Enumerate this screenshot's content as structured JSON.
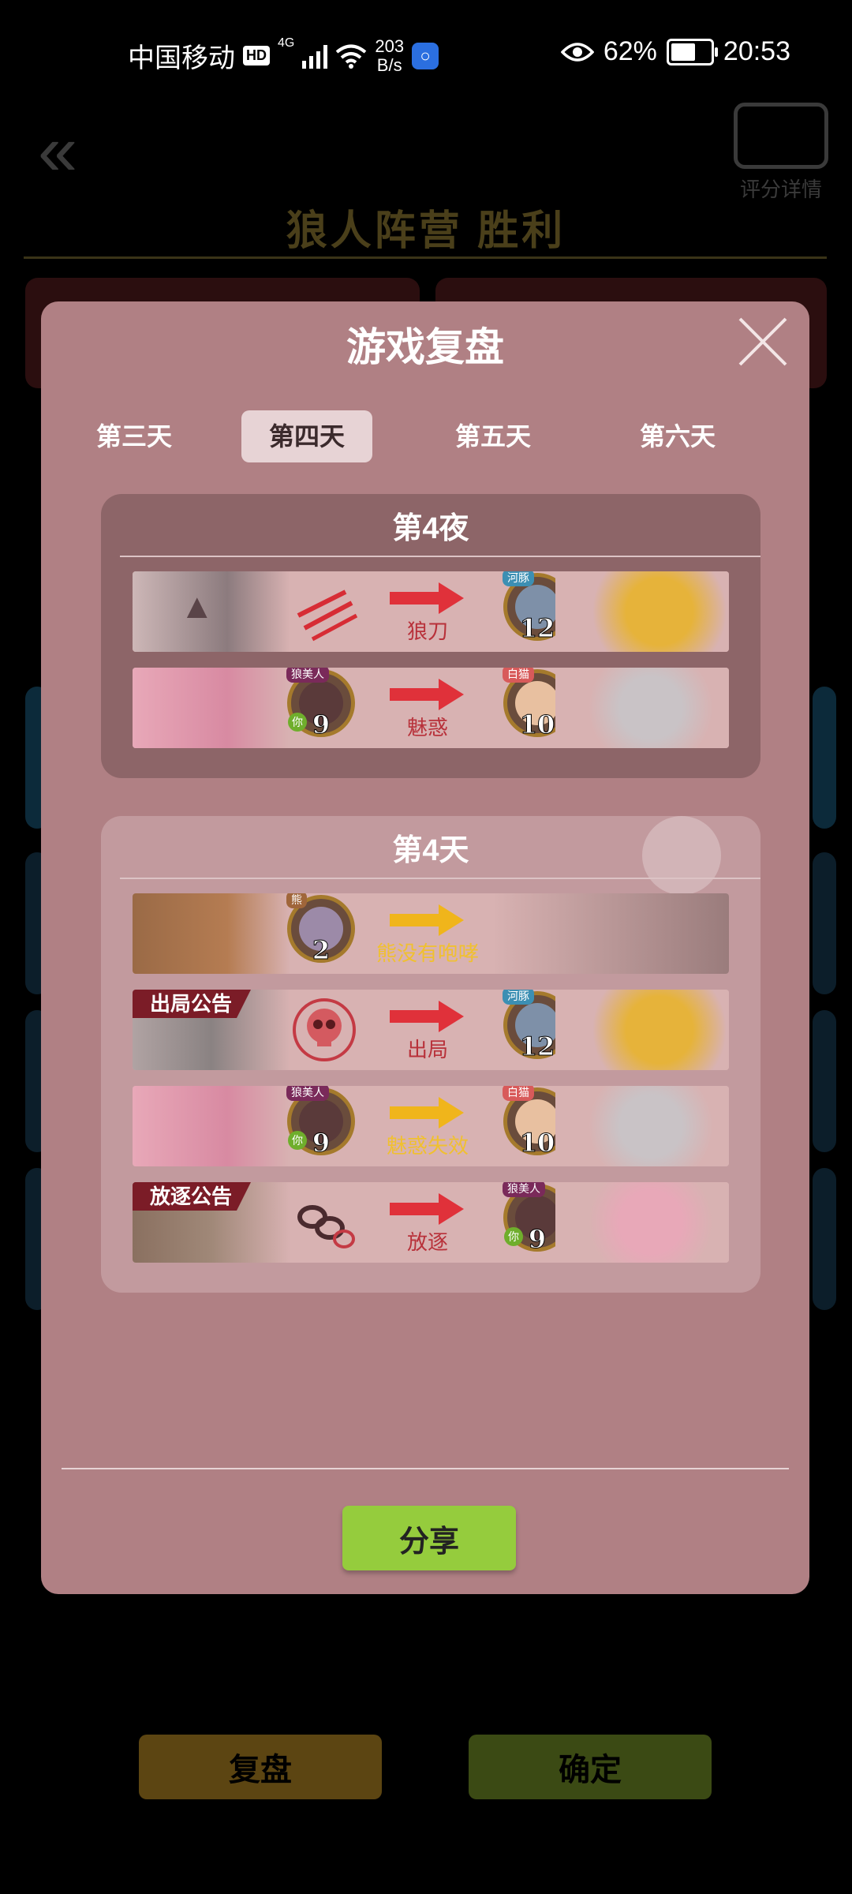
{
  "status_bar": {
    "carrier": "中国移动",
    "hd": "HD",
    "net_type": "4G",
    "net_speed": "203",
    "net_unit": "B/s",
    "battery_percent_text": "62%",
    "battery_level": 0.62,
    "time": "20:53"
  },
  "background": {
    "score_detail": "评分详情",
    "result_title": "狼人阵营  胜利",
    "replay_label": "复盘",
    "confirm_label": "确定"
  },
  "modal": {
    "title": "游戏复盘",
    "tabs": [
      {
        "label": "第三天",
        "active": false
      },
      {
        "label": "第四天",
        "active": true
      },
      {
        "label": "第五天",
        "active": false
      },
      {
        "label": "第六天",
        "active": false
      }
    ],
    "night": {
      "title": "第4夜",
      "rows": [
        {
          "action": "狼刀",
          "arrow": "red",
          "target": {
            "role": "河豚",
            "number": "12"
          }
        },
        {
          "action": "魅惑",
          "arrow": "red",
          "actor": {
            "role": "狼美人",
            "number": "9",
            "you": "你"
          },
          "target": {
            "role": "白猫",
            "number": "10"
          }
        }
      ]
    },
    "day": {
      "title": "第4天",
      "rows": [
        {
          "action": "熊没有咆哮",
          "arrow": "yellow",
          "actor": {
            "role": "熊",
            "number": "2"
          }
        },
        {
          "ribbon": "出局公告",
          "action": "出局",
          "arrow": "red",
          "target": {
            "role": "河豚",
            "number": "12"
          }
        },
        {
          "action": "魅惑失效",
          "arrow": "yellow",
          "actor": {
            "role": "狼美人",
            "number": "9",
            "you": "你"
          },
          "target": {
            "role": "白猫",
            "number": "10"
          }
        },
        {
          "ribbon": "放逐公告",
          "action": "放逐",
          "arrow": "red",
          "target": {
            "role": "狼美人",
            "number": "9",
            "you": "你"
          }
        }
      ]
    },
    "share_label": "分享"
  },
  "colors": {
    "modal_bg": "#b08084",
    "share_green": "#95cc3d",
    "arrow_red": "#e0313a",
    "arrow_yellow": "#f0b51b"
  }
}
